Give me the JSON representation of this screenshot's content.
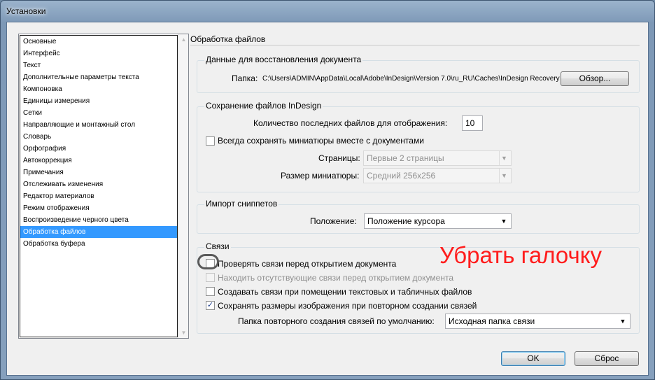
{
  "window": {
    "title": "Установки"
  },
  "sidebar": {
    "items": [
      {
        "label": "Основные"
      },
      {
        "label": "Интерфейс"
      },
      {
        "label": "Текст"
      },
      {
        "label": "Дополнительные параметры текста"
      },
      {
        "label": "Компоновка"
      },
      {
        "label": "Единицы измерения"
      },
      {
        "label": "Сетки"
      },
      {
        "label": "Направляющие и монтажный стол"
      },
      {
        "label": "Словарь"
      },
      {
        "label": "Орфография"
      },
      {
        "label": "Автокоррекция"
      },
      {
        "label": "Примечания"
      },
      {
        "label": "Отслеживать изменения"
      },
      {
        "label": "Редактор материалов"
      },
      {
        "label": "Режим отображения"
      },
      {
        "label": "Воспроизведение черного цвета"
      },
      {
        "label": "Обработка файлов",
        "selected": true
      },
      {
        "label": "Обработка буфера"
      }
    ]
  },
  "panel": {
    "title": "Обработка файлов",
    "recovery": {
      "title": "Данные для восстановления документа",
      "folder_label": "Папка:",
      "folder_path": "C:\\Users\\ADMIN\\AppData\\Local\\Adobe\\InDesign\\Version 7.0\\ru_RU\\Caches\\InDesign Recovery",
      "browse_button": "Обзор..."
    },
    "saving": {
      "title": "Сохранение файлов InDesign",
      "recent_count_label": "Количество последних файлов для отображения:",
      "recent_count_value": "10",
      "save_thumbnails_label": "Всегда сохранять миниатюры вместе с документами",
      "save_thumbnails_checked": false,
      "pages_label": "Страницы:",
      "pages_value": "Первые 2 страницы",
      "thumb_size_label": "Размер миниатюры:",
      "thumb_size_value": "Средний 256x256"
    },
    "snippets": {
      "title": "Импорт сниппетов",
      "position_label": "Положение:",
      "position_value": "Положение курсора"
    },
    "links": {
      "title": "Связи",
      "check_links_label": "Проверять связи перед открытием документа",
      "check_links_checked": false,
      "find_missing_label": "Находить отсутствующие связи перед открытием документа",
      "find_missing_checked": false,
      "create_links_label": "Создавать связи при помещении текстовых и табличных файлов",
      "create_links_checked": false,
      "preserve_dims_label": "Сохранять размеры изображения при повторном создании связей",
      "preserve_dims_checked": true,
      "relink_folder_label": "Папка повторного создания связей по умолчанию:",
      "relink_folder_value": "Исходная папка связи"
    }
  },
  "footer": {
    "ok_button": "OK",
    "reset_button": "Сброс"
  },
  "annotation": {
    "text": "Убрать галочку",
    "color": "#ff1c1c"
  },
  "icons": {
    "check": "✓",
    "dropdown": "▼",
    "scroll_up": "▲",
    "scroll_down": "▼"
  }
}
